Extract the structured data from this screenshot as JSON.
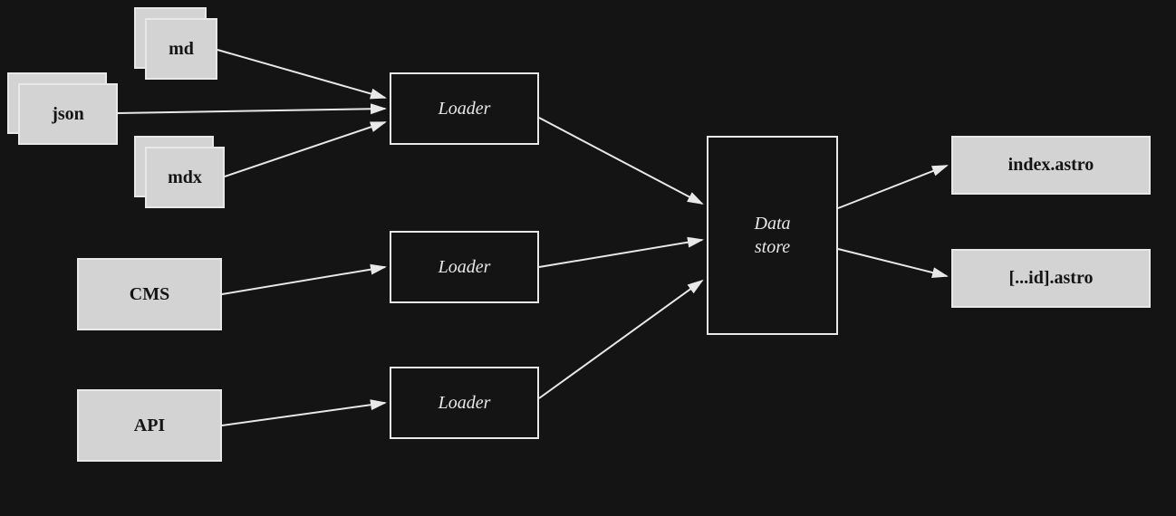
{
  "sources": {
    "md": "md",
    "json": "json",
    "mdx": "mdx",
    "cms": "CMS",
    "api": "API"
  },
  "loaders": {
    "loader1": "Loader",
    "loader2": "Loader",
    "loader3": "Loader"
  },
  "store": {
    "line1": "Data",
    "line2": "store"
  },
  "outputs": {
    "index": "index.astro",
    "dynamic": "[...id].astro"
  }
}
